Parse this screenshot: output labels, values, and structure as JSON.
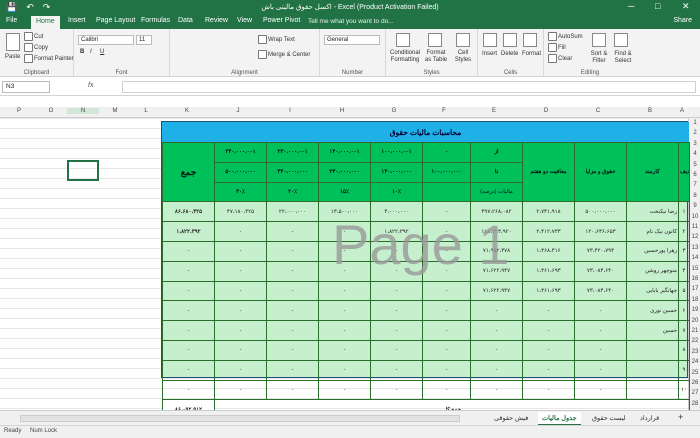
{
  "window": {
    "title": "اکسل حقوق مالیتی باش - Excel (Product Activation Failed)",
    "minimize": "─",
    "restore": "□",
    "close": "✕"
  },
  "quick_access": {
    "save": "💾",
    "undo": "↶",
    "redo": "↷"
  },
  "tabs": [
    "File",
    "Home",
    "Insert",
    "Page Layout",
    "Formulas",
    "Data",
    "Review",
    "View",
    "Power Pivot"
  ],
  "tell_me": "Tell me what you want to do...",
  "share": "Share",
  "ribbon": {
    "clipboard": {
      "label": "Clipboard",
      "paste": "Paste",
      "cut": "Cut",
      "copy": "Copy",
      "format_painter": "Format Painter"
    },
    "font": {
      "label": "Font",
      "font_name": "Calibri",
      "font_size": "11",
      "bold": "B",
      "italic": "I",
      "underline": "U"
    },
    "alignment": {
      "label": "Alignment",
      "wrap": "Wrap Text",
      "merge": "Merge & Center"
    },
    "number": {
      "label": "Number",
      "format": "General"
    },
    "styles": {
      "label": "Styles",
      "conditional": "Conditional Formatting",
      "format_table": "Format as Table",
      "cell_styles": "Cell Styles"
    },
    "cells": {
      "label": "Cells",
      "insert": "Insert",
      "delete": "Delete",
      "format": "Format"
    },
    "editing": {
      "label": "Editing",
      "autosum": "AutoSum",
      "fill": "Fill",
      "clear": "Clear",
      "sort": "Sort & Filter",
      "find": "Find & Select"
    }
  },
  "namebox": "N3",
  "fx": "fx",
  "columns": [
    "P",
    "O",
    "N",
    "M",
    "L",
    "K",
    "J",
    "I",
    "H",
    "G",
    "F",
    "E",
    "D",
    "C",
    "B",
    "A"
  ],
  "rows": [
    "1",
    "2",
    "3",
    "4",
    "5",
    "6",
    "7",
    "8",
    "9",
    "10",
    "11",
    "12",
    "13",
    "14",
    "15",
    "16",
    "17",
    "18",
    "19",
    "20",
    "21",
    "22",
    "23",
    "24",
    "25",
    "26",
    "27",
    "28"
  ],
  "table": {
    "banner": "محاسبات مالیات حقوق",
    "h_radif": "ردیف",
    "h_karmand": "کارمند",
    "h_hoghugh": "حقوق و مزایا",
    "h_moafiat": "معافیت دو هفتم",
    "h_az": "از",
    "h_ta": "تا",
    "h_darsad": "مالیات (درصد)",
    "h_jam": "جمع",
    "brackets_from": [
      "۰",
      "۱۰۰،۰۰۰،۰۰۱",
      "۱۴۰،۰۰۰،۰۰۱",
      "۲۳۰،۰۰۰،۰۰۱",
      "۳۴۰،۰۰۰،۰۰۱"
    ],
    "brackets_to": [
      "۱۰۰،۰۰۰،۰۰۰",
      "۱۴۰،۰۰۰،۰۰۰",
      "۲۳۰،۰۰۰،۰۰۰",
      "۳۴۰،۰۰۰،۰۰۰",
      "۵۰۰،۰۰۰،۰۰۰"
    ],
    "brackets_rate": [
      "",
      "۱۰٪",
      "۱۵٪",
      "۲۰٪",
      "۳۰٪"
    ],
    "rows": [
      {
        "n": "۱",
        "name": "رضا نیکبخت",
        "sal": "۵۰۰،۰۰۰،۰۰۰",
        "moaf": "۲،۷۳۱،۹۱۸",
        "net": "۴۹۷،۲۶۸،۰۸۲",
        "t1": "-",
        "t2": "۴،۰۰۰،۰۰۰",
        "t3": "۱۳،۵۰۰،۰۰۰",
        "t4": "۲۲،۰۰۰،۰۰۰",
        "t5": "۴۷،۱۸۰،۴۲۵",
        "sum": "۸۶،۶۸۰،۴۲۵"
      },
      {
        "n": "۲",
        "name": "کاتون نیک نام",
        "sal": "۱۲۰،۶۳۶،۶۵۳",
        "moaf": "۲،۴۱۲،۷۳۳",
        "net": "۱۱۸،۲۲۳،۹۲۰",
        "t1": "-",
        "t2": "۱،۸۲۲،۳۹۲",
        "t3": "-",
        "t4": "-",
        "t5": "-",
        "sum": "۱،۸۲۲،۳۹۲"
      },
      {
        "n": "۳",
        "name": "زهرا پورحسین",
        "sal": "۷۳،۴۲۰،۷۹۴",
        "moaf": "۱،۴۶۸،۴۱۶",
        "net": "۷۱،۹۵۲،۳۷۸",
        "t1": "-",
        "t2": "-",
        "t3": "-",
        "t4": "-",
        "t5": "-",
        "sum": "-"
      },
      {
        "n": "۴",
        "name": "منوچهر روشن",
        "sal": "۷۳،۰۸۴،۶۴۰",
        "moaf": "۱،۴۶۱،۶۹۳",
        "net": "۷۱،۶۲۲،۹۴۷",
        "t1": "-",
        "t2": "-",
        "t3": "-",
        "t4": "-",
        "t5": "-",
        "sum": "-"
      },
      {
        "n": "۵",
        "name": "جهانگیر بابایی",
        "sal": "۷۳،۰۸۴،۶۴۰",
        "moaf": "۱،۴۶۱،۶۹۳",
        "net": "۷۱،۶۲۲،۹۴۷",
        "t1": "-",
        "t2": "-",
        "t3": "-",
        "t4": "-",
        "t5": "-",
        "sum": "-"
      },
      {
        "n": "۶",
        "name": "حسین نوری",
        "sal": "-",
        "moaf": "-",
        "net": "-",
        "t1": "-",
        "t2": "-",
        "t3": "-",
        "t4": "-",
        "t5": "-",
        "sum": "-"
      },
      {
        "n": "۷",
        "name": "حسین",
        "sal": "-",
        "moaf": "-",
        "net": "-",
        "t1": "-",
        "t2": "-",
        "t3": "-",
        "t4": "-",
        "t5": "-",
        "sum": "-"
      },
      {
        "n": "۸",
        "name": "",
        "sal": "-",
        "moaf": "-",
        "net": "-",
        "t1": "-",
        "t2": "-",
        "t3": "-",
        "t4": "-",
        "t5": "-",
        "sum": "-"
      },
      {
        "n": "۹",
        "name": "",
        "sal": "-",
        "moaf": "-",
        "net": "-",
        "t1": "-",
        "t2": "-",
        "t3": "-",
        "t4": "-",
        "t5": "-",
        "sum": "-"
      },
      {
        "n": "۱۰",
        "name": "",
        "sal": "-",
        "moaf": "-",
        "net": "-",
        "t1": "-",
        "t2": "-",
        "t3": "-",
        "t4": "-",
        "t5": "-",
        "sum": "-"
      }
    ],
    "total_label": "جمع کل",
    "total_value": "۸۶،۰۹۲،۹۱۲"
  },
  "watermark": "Page 1",
  "sheet_tabs": [
    "قرارداد",
    "لیست حقوق",
    "جدول مالیات",
    "فیش حقوقی"
  ],
  "sheet_add": "+",
  "status": {
    "ready": "Ready",
    "numlock": "Num Lock"
  }
}
